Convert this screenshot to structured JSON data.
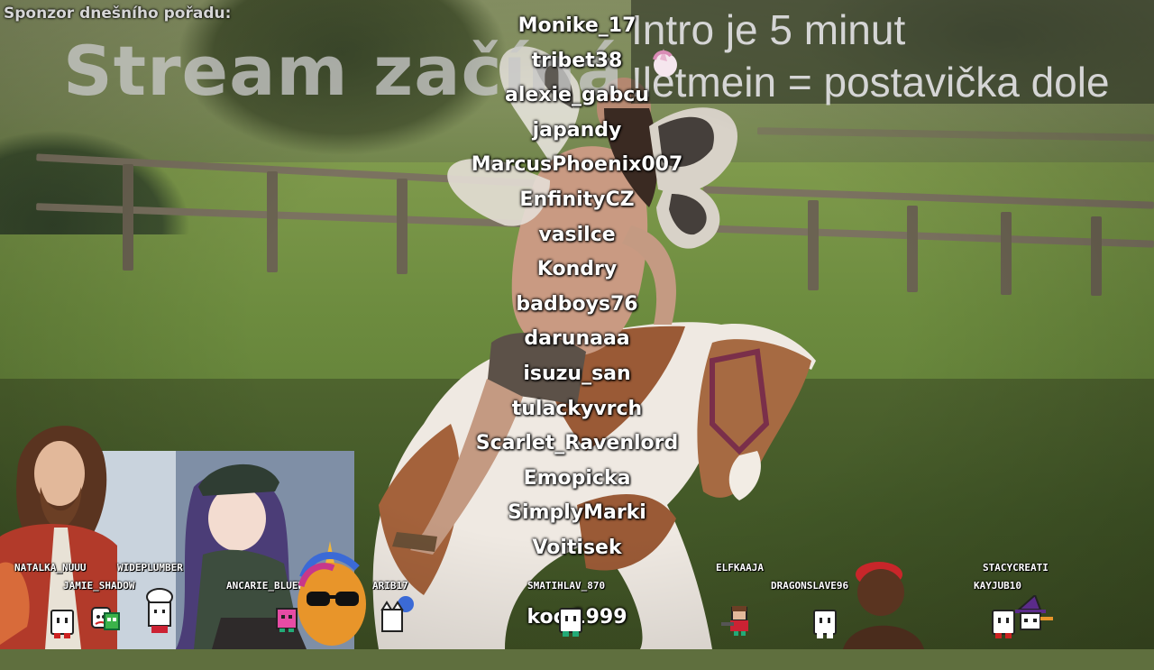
{
  "sponsor_label": "Sponzor dnešního pořadu:",
  "title": "Stream začíná",
  "info": {
    "line1": "Intro je 5 minut",
    "line2": "!letmein = postavička dole"
  },
  "credits": [
    "Monike_17",
    "tribet38",
    "alexie_gabcu",
    "japandy",
    "MarcusPhoenix007",
    "EnfinityCZ",
    "vasilce",
    "Kondry",
    "badboys76",
    "darunaaa",
    "isuzu_san",
    "tulackyvrch",
    "Scarlet_Ravenlord",
    "Emopicka",
    "SimplyMarki",
    "Voitisek",
    "",
    "koc 1999",
    ""
  ],
  "chat_names": [
    "NATALKA_NUUU",
    "WIDEPLUMBER",
    "JAMIE_SHADOW",
    "ANCARIE_BLUEWOLF",
    "ARIB17",
    "SMATIHLAV_870",
    "ELFKAAJA",
    "DRAGONSLAVE96",
    "STACYCREATI",
    "KAYJUB10"
  ],
  "colors": {
    "credit_text": "#ffffff",
    "title_text": "#c8c8c8",
    "info_text": "#d5d5d5"
  }
}
